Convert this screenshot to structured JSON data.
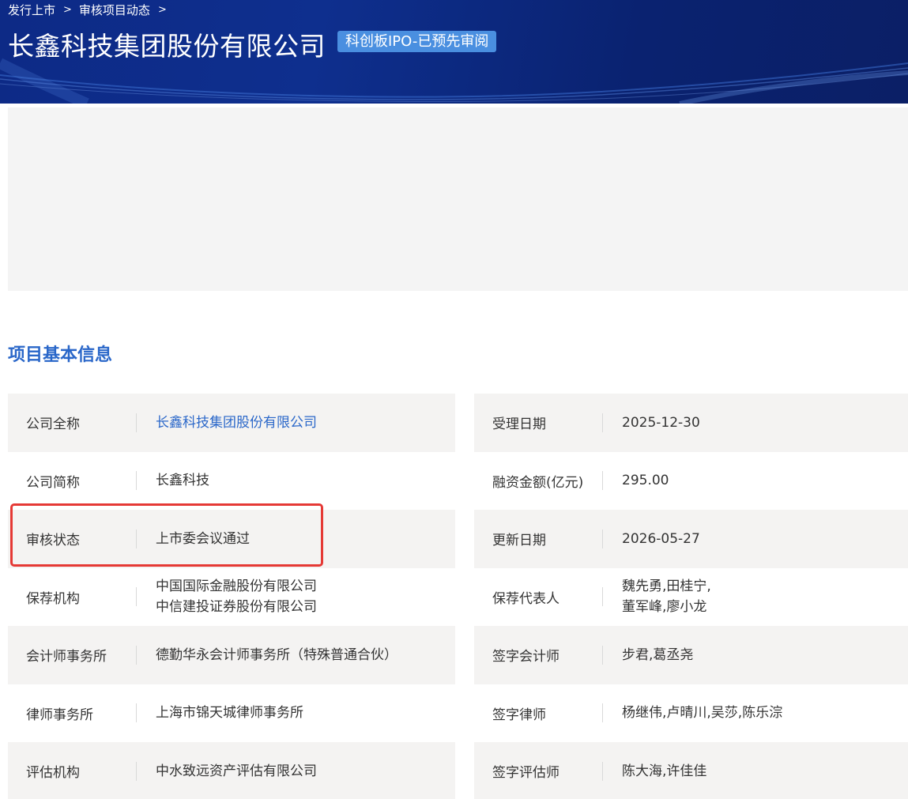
{
  "breadcrumb": {
    "items": [
      "发行上市",
      "审核项目动态"
    ],
    "separator": ">"
  },
  "header": {
    "title": "长鑫科技集团股份有限公司",
    "tag": "科创板IPO-已预先审阅"
  },
  "section": {
    "title": "项目基本信息"
  },
  "info": {
    "rows": [
      {
        "left": {
          "label": "公司全称",
          "value": "长鑫科技集团股份有限公司",
          "link": true
        },
        "right": {
          "label": "受理日期",
          "value": "2025-12-30"
        }
      },
      {
        "left": {
          "label": "公司简称",
          "value": "长鑫科技"
        },
        "right": {
          "label": "融资金额(亿元)",
          "value": "295.00"
        }
      },
      {
        "left": {
          "label": "审核状态",
          "value": "上市委会议通过"
        },
        "right": {
          "label": "更新日期",
          "value": "2026-05-27"
        }
      },
      {
        "left": {
          "label": "保荐机构",
          "value": [
            "中国国际金融股份有限公司",
            "中信建投证券股份有限公司"
          ]
        },
        "right": {
          "label": "保荐代表人",
          "value": [
            "魏先勇,田桂宁,",
            "董军峰,廖小龙"
          ]
        }
      },
      {
        "left": {
          "label": "会计师事务所",
          "value": "德勤华永会计师事务所（特殊普通合伙）"
        },
        "right": {
          "label": "签字会计师",
          "value": "步君,葛丞尧"
        }
      },
      {
        "left": {
          "label": "律师事务所",
          "value": "上海市锦天城律师事务所"
        },
        "right": {
          "label": "签字律师",
          "value": "杨继伟,卢晴川,吴莎,陈乐淙"
        }
      },
      {
        "left": {
          "label": "评估机构",
          "value": "中水致远资产评估有限公司"
        },
        "right": {
          "label": "签字评估师",
          "value": "陈大海,许佳佳"
        }
      }
    ]
  },
  "colors": {
    "banner": "#0d2a86",
    "tag": "#4a8fe0",
    "link": "#2a67c9",
    "row_shade": "#f4f3f2",
    "highlight": "#e53935"
  }
}
